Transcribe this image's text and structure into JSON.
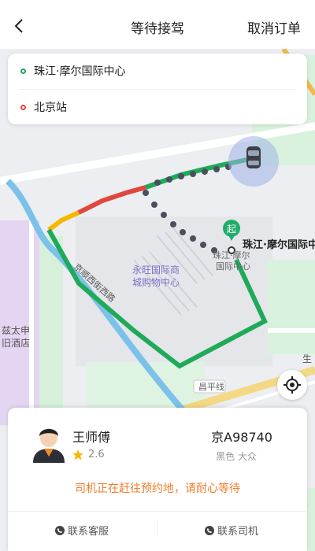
{
  "header": {
    "title": "等待接驾",
    "cancel_label": "取消订单"
  },
  "route": {
    "origin": "珠江·摩尔国际中心",
    "destination": "北京站"
  },
  "map": {
    "start_marker_label": "起",
    "origin_label": "珠江·摩尔国际中心",
    "poi_label_1": "永旺国际商",
    "poi_label_2": "城购物中心",
    "poi_small_1": "珠江·摩尔",
    "poi_small_2": "国际中心",
    "road_label": "京顺西街西路",
    "left_label_1": "兹太申",
    "left_label_2": "旧酒店",
    "right_label": "生",
    "line_label": "昌平线",
    "colors": {
      "route_green": "#1faa5a",
      "route_red": "#e0473d",
      "route_yellow": "#f5b800",
      "dotted": "#4a4f5c",
      "river": "#7cc1ea"
    }
  },
  "driver": {
    "name": "王师傅",
    "rating": "2.6",
    "plate": "京A98740",
    "car": "黑色 大众",
    "status": "司机正在赶往预约地，请耐心等待"
  },
  "actions": {
    "contact_service": "联系客服",
    "contact_driver": "联系司机"
  }
}
